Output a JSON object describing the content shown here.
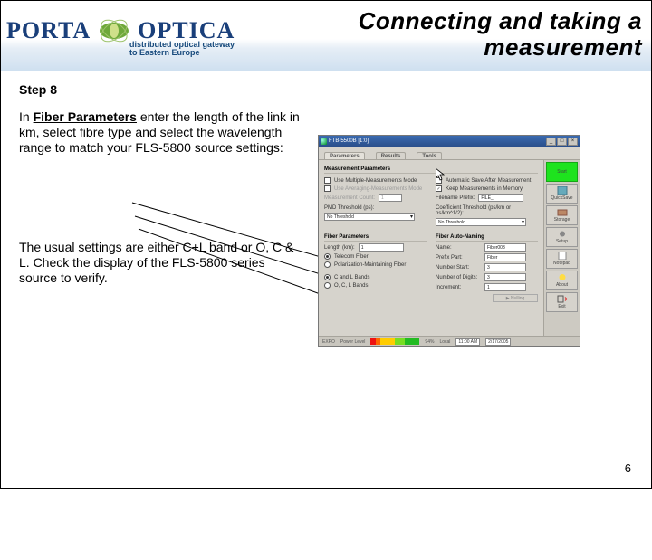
{
  "header": {
    "logo_a": "PORTA",
    "logo_b": "OPTICA",
    "tagline_l1": "distributed optical gateway",
    "tagline_l2": "to Eastern Europe",
    "title_l1": "Connecting and taking a",
    "title_l2": "measurement"
  },
  "body": {
    "step": "Step 8",
    "para1_pre": "In ",
    "para1_u": "Fiber Parameters",
    "para1_post": " enter the length of the link in km, select fibre type and select the wavelength range to match your FLS-5800 source settings:",
    "para2": "The usual settings are either C+L band or O, C & L. Check the display of the FLS-5800 series source to verify."
  },
  "page_number": "6",
  "app": {
    "title": "FTB-5500B [1:0]",
    "winbtns": {
      "min": "_",
      "max": "□",
      "close": "×"
    },
    "tabs": {
      "parameters": "Parameters",
      "results": "Results",
      "tools": "Tools"
    },
    "sections": {
      "measurement": "Measurement Parameters",
      "fiber_params": "Fiber Parameters",
      "fiber_auto": "Fiber Auto-Naming"
    },
    "checks": {
      "multi": "Use Multiple-Measurements Mode",
      "autosave": "Automatic Save After Measurement",
      "keep": "Keep Measurements in Memory",
      "averaging": "Use Averaging-Measurements Mode"
    },
    "labels": {
      "filename_prefix": "Filename Prefix:",
      "meas_count": "Measurement Count:",
      "pmd_threshold": "PMD Threshold (ps):",
      "coeff_threshold": "Coefficient Threshold (ps/km or ps/km^1/2):",
      "length": "Length (km):",
      "name": "Name:",
      "prefix": "Prefix Part:",
      "numstart": "Number Start:",
      "numdigits": "Number of Digits:",
      "increment": "Increment:"
    },
    "values": {
      "filename_prefix": "FILE_",
      "meas_count": "1",
      "no_threshold": "No Threshold",
      "length": "1",
      "name": "Fiber003",
      "prefix": "Fiber",
      "numstart": "3",
      "numdigits": "3",
      "increment": "1"
    },
    "fiber_radios": {
      "telecom": "Telecom Fiber",
      "pm": "Polarization-Maintaining Fiber"
    },
    "band_radios": {
      "cl": "C and L Bands",
      "ocl": "O, C, L Bands"
    },
    "sidebar": {
      "start": "Start",
      "quicksave": "QuickSave",
      "storage": "Storage",
      "setup": "Setup",
      "notepad": "Notepad",
      "about": "About",
      "exit": "Exit"
    },
    "status": {
      "expo": "EXPO",
      "power": "Power Level",
      "pct": "94%",
      "local": "Local",
      "time": "11:00 AM",
      "date": "2/17/2005"
    },
    "nulling": "Nulling"
  }
}
